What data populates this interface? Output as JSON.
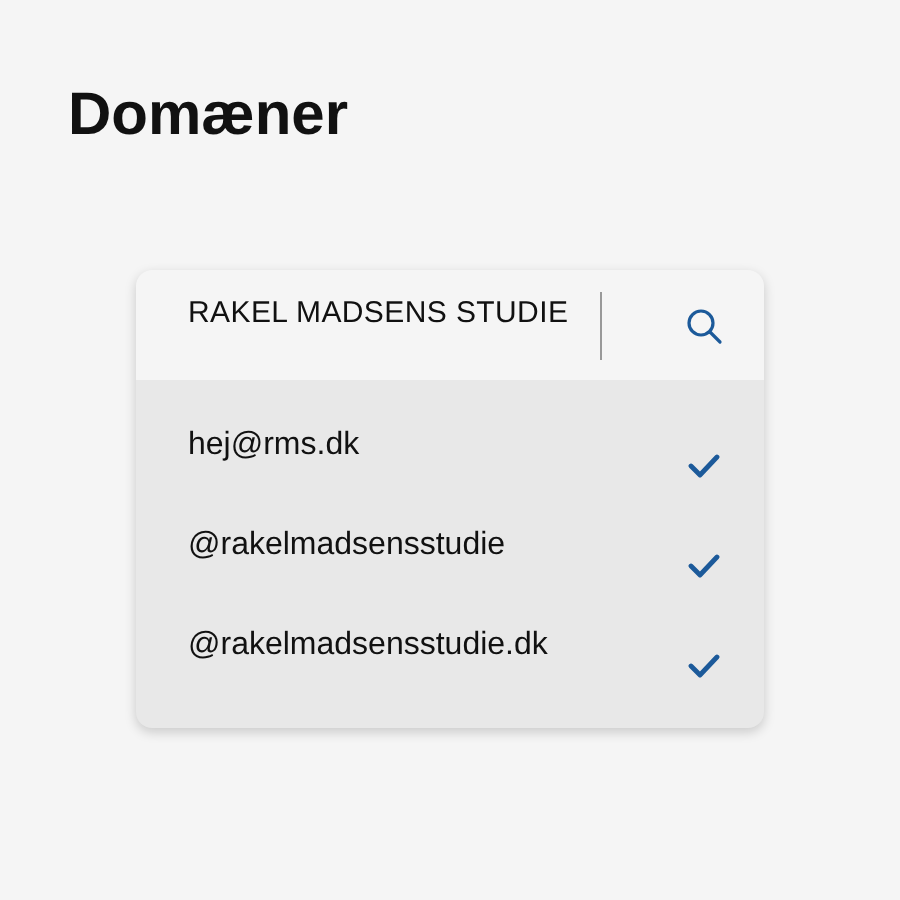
{
  "title": "Domæner",
  "card": {
    "header": "RAKEL MADSENS STUDIE",
    "domains": [
      {
        "name": "hej@rms.dk",
        "checked": true
      },
      {
        "name": "@rakelmadsensstudie",
        "checked": true
      },
      {
        "name": "@rakelmadsensstudie.dk",
        "checked": true
      }
    ]
  }
}
